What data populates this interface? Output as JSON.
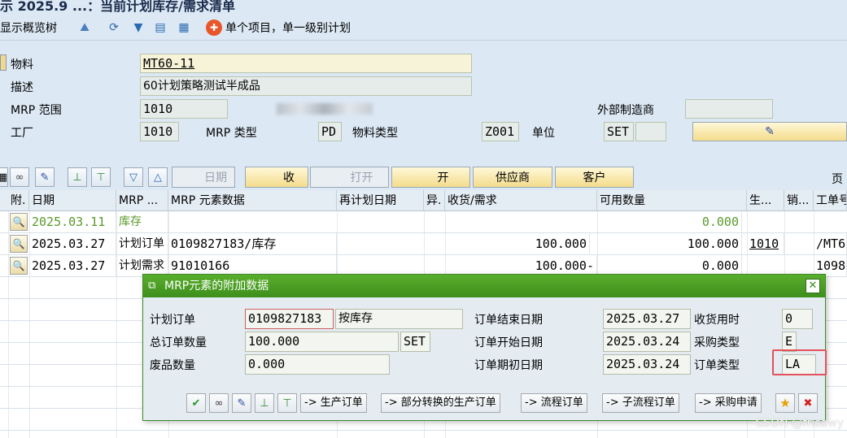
{
  "window": {
    "title": "示 2025.9 ...：当前计划库存/需求清单"
  },
  "app_toolbar": {
    "show_overview_label": "显示概览树",
    "mode_label": "单个项目，单一级别计划"
  },
  "header": {
    "material_label": "物料",
    "material_value": "MT60-11",
    "description_label": "描述",
    "description_value": "60计划策略测试半成品",
    "mrp_area_label": "MRP 范围",
    "mrp_area_value": "1010",
    "external_vendor_label": "外部制造商",
    "external_vendor_value": "",
    "plant_label": "工厂",
    "plant_value": "1010",
    "mrp_type_label": "MRP 类型",
    "mrp_type_value": "PD",
    "material_type_label": "物料类型",
    "material_type_value": "Z001",
    "unit_label": "单位",
    "unit_value": "SET"
  },
  "grid_toolbar": {
    "date_btn": "日期",
    "receive_btn": "收",
    "open_btn": "打开",
    "open2_btn": "开",
    "vendor_btn": "供应商",
    "customer_btn": "客户",
    "page_label": "页"
  },
  "table": {
    "columns": [
      "附.",
      "日期",
      "MRP ...",
      "MRP 元素数据",
      "再计划日期",
      "异.",
      "收货/需求",
      "可用数量",
      "生...",
      "销...",
      "工单号"
    ],
    "rows": [
      {
        "date": "2025.03.11",
        "element": "库存",
        "data": "",
        "reschedule": "",
        "exc": "",
        "qty": "",
        "available": "0.000",
        "prod": "",
        "sales": "",
        "order": ""
      },
      {
        "date": "2025.03.27",
        "element": "计划订单",
        "data": "0109827183/库存",
        "reschedule": "",
        "exc": "",
        "qty": "100.000",
        "available": "100.000",
        "prod": "1010",
        "sales": "",
        "order": "/MT6"
      },
      {
        "date": "2025.03.27",
        "element": "计划需求",
        "data": "91010166",
        "reschedule": "",
        "exc": "",
        "qty": "100.000-",
        "available": "0.000",
        "prod": "",
        "sales": "",
        "order": "1098"
      }
    ]
  },
  "popup": {
    "title": "MRP元素的附加数据",
    "planned_order_label": "计划订单",
    "planned_order_value": "0109827183",
    "planned_order_text": "按库存",
    "total_qty_label": "总订单数量",
    "total_qty_value": "100.000",
    "total_qty_unit": "SET",
    "scrap_label": "废品数量",
    "scrap_value": "0.000",
    "order_end_label": "订单结束日期",
    "order_end_value": "2025.03.27",
    "order_start_label": "订单开始日期",
    "order_start_value": "2025.03.24",
    "order_open_label": "订单期初日期",
    "order_open_value": "2025.03.24",
    "gr_time_label": "收货用时",
    "gr_time_value": "0",
    "procurement_type_label": "采购类型",
    "procurement_type_value": "E",
    "order_type_label": "订单类型",
    "order_type_value": "LA",
    "buttons": {
      "prod_order": "-> 生产订单",
      "partial_convert": "-> 部分转换的生产订单",
      "process_order": "-> 流程订单",
      "sub_process_order": "-> 子流程订单",
      "purchase_req": "-> 采购申请"
    }
  },
  "watermark": "CSDN @frisawy",
  "colors": {
    "popup_title": "#4a9e24",
    "highlight": "#e5505a",
    "accent_button": "#f4dc8c"
  }
}
